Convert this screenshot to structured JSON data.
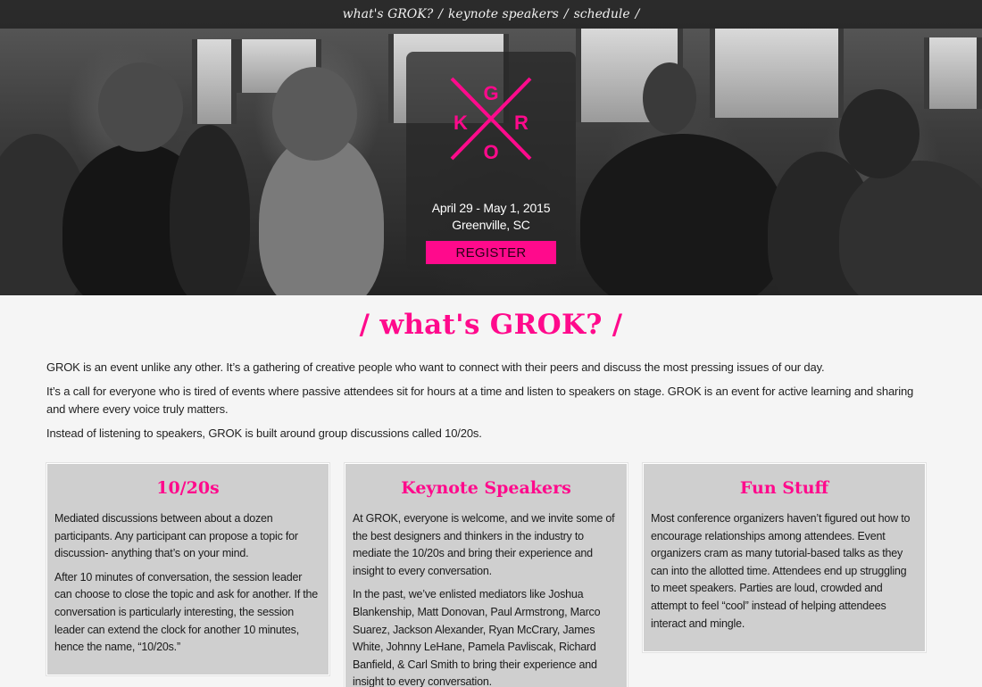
{
  "nav": {
    "items": [
      "what's GROK?",
      "keynote speakers",
      "schedule"
    ],
    "separator": "/"
  },
  "hero": {
    "logo_letters": [
      "G",
      "K",
      "R",
      "O"
    ],
    "date": "April 29 - May 1, 2015",
    "location": "Greenville, SC",
    "register_label": "REGISTER"
  },
  "about": {
    "title": "/ what's GROK? /",
    "paragraphs": [
      "GROK is an event unlike any other. It’s a gathering of creative people who want to connect with their peers and discuss the most pressing issues of our day.",
      "It’s a call for everyone who is tired of events where passive attendees sit for hours at a time and listen to speakers on stage. GROK is an event for active learning and sharing and where every voice truly matters.",
      "Instead of listening to speakers, GROK is built around group discussions called 10/20s."
    ]
  },
  "cards": [
    {
      "title": "10/20s",
      "paragraphs": [
        "Mediated discussions between about a dozen participants. Any participant can propose a topic for discussion- anything that’s on your mind.",
        "After 10 minutes of conversation, the session leader can choose to close the topic and ask for another. If the conversation is particularly interesting, the session leader can extend the clock for another 10 minutes, hence the name, “10/20s.”"
      ]
    },
    {
      "title": "Keynote Speakers",
      "paragraphs": [
        "At GROK, everyone is welcome, and we invite some of the best designers and thinkers in the industry to mediate the 10/20s and bring their experience and insight to every conversation.",
        "In the past, we’ve enlisted mediators like Joshua Blankenship, Matt Donovan, Paul Armstrong, Marco Suarez, Jackson Alexander, Ryan McCrary, James White, Johnny LeHane, Pamela Pavliscak, Richard Banfield, & Carl Smith to bring their experience and insight to every conversation."
      ]
    },
    {
      "title": "Fun Stuff",
      "paragraphs": [
        "Most conference organizers haven’t figured out how to encourage relationships among attendees. Event organizers cram as many tutorial-based talks as they can into the allotted time. Attendees end up struggling to meet speakers. Parties are loud, crowded and attempt to feel “cool” instead of helping attendees interact and mingle."
      ]
    }
  ],
  "colors": {
    "accent": "#ff0a8c",
    "card_bg": "#cfcfcf",
    "page_bg": "#f5f5f5"
  }
}
